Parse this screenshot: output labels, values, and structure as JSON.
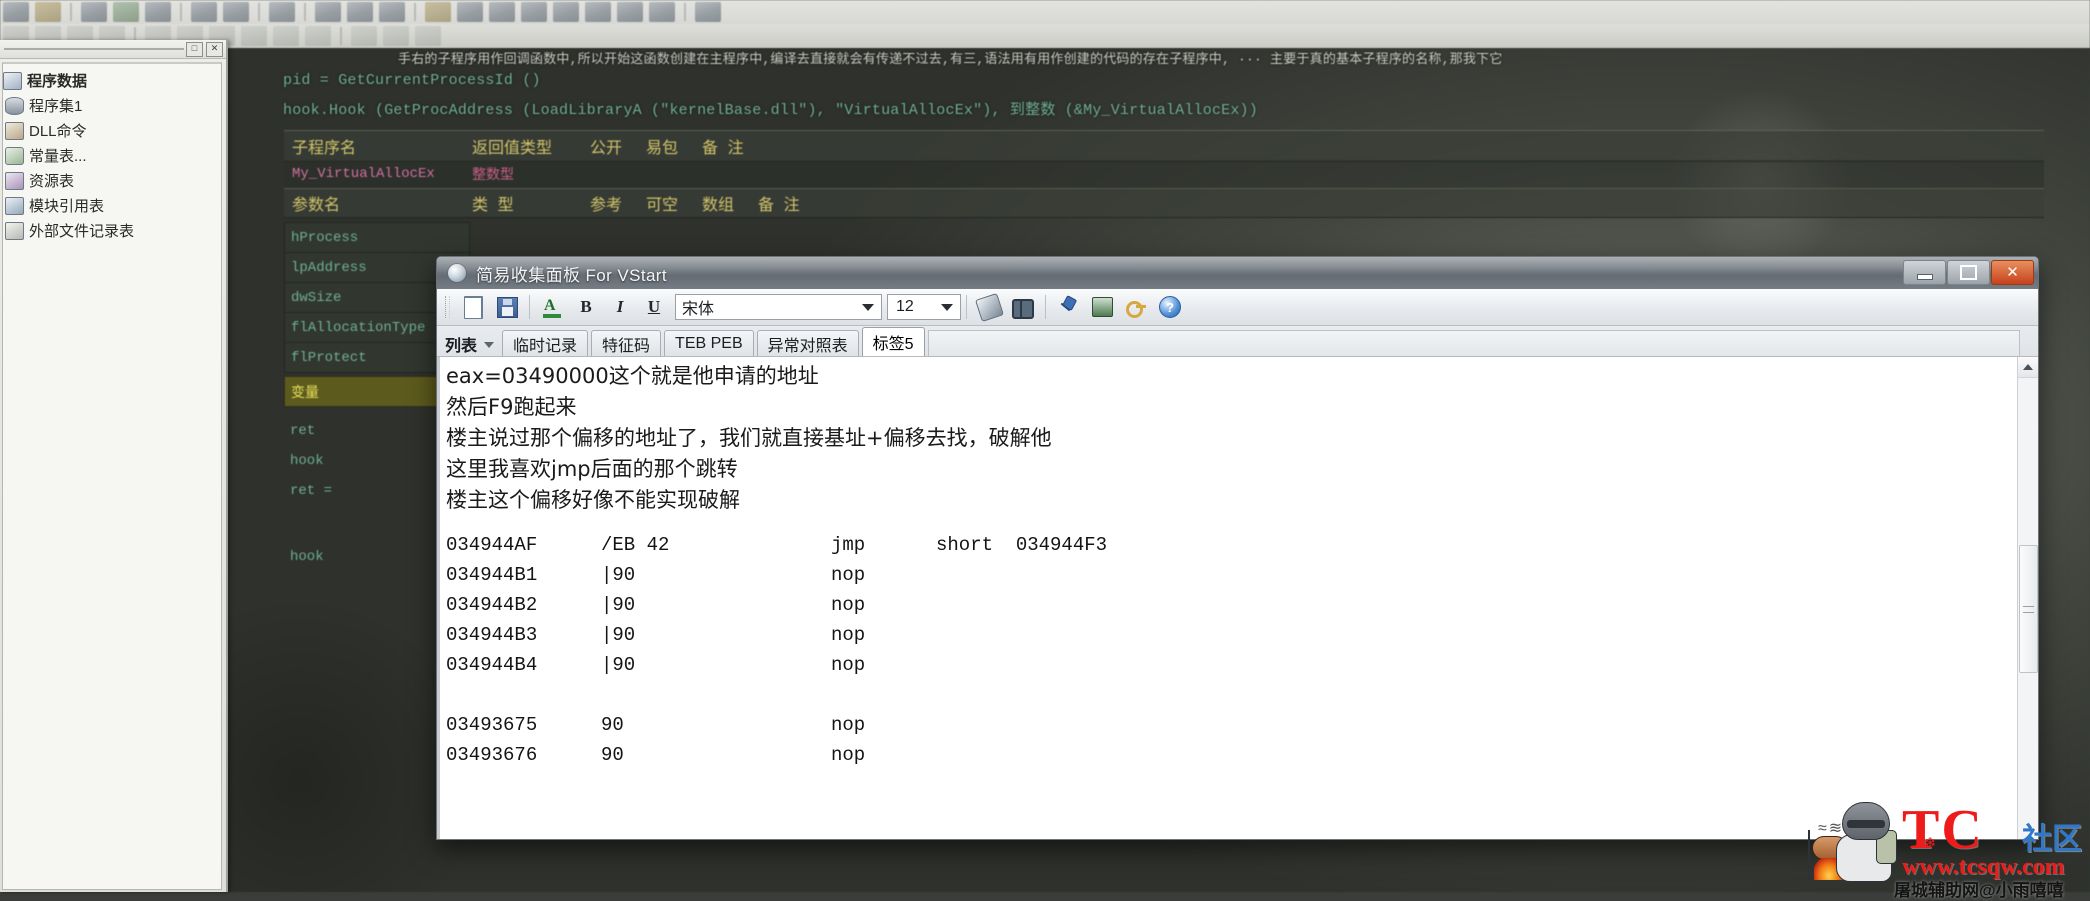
{
  "toolbar_top": {
    "row1_icons": [
      "open-icon",
      "save-icon",
      "run-icon",
      "debug-icon",
      "copy-icon",
      "paste-icon",
      "undo-icon",
      "redo-icon",
      "zoom-icon",
      "window-icon",
      "layout-icon",
      "grid-icon",
      "play-icon",
      "stop-icon",
      "settings-icon",
      "step-icon",
      "step-over-icon",
      "step-out-icon",
      "watch-icon",
      "breakpoint-icon",
      "search-icon"
    ],
    "row2_icons": [
      "align-left-icon",
      "align-center-icon",
      "align-right-icon",
      "spacing-icon",
      "group-icon",
      "ungroup-icon",
      "bring-front-icon",
      "send-back-icon",
      "size-width-icon",
      "size-height-icon",
      "table-icon",
      "list-icon",
      "property-icon"
    ]
  },
  "left_panel": {
    "caption_buttons": [
      "restore-button",
      "close-button"
    ],
    "items": [
      {
        "label": "程序数据",
        "icon": "folder-icon",
        "root": true
      },
      {
        "label": "程序集1",
        "icon": "assembly-icon",
        "root": false
      },
      {
        "label": "DLL命令",
        "icon": "dll-icon",
        "root": false
      },
      {
        "label": "常量表...",
        "icon": "constant-icon",
        "root": false
      },
      {
        "label": "资源表",
        "icon": "resource-icon",
        "root": false
      },
      {
        "label": "模块引用表",
        "icon": "module-icon",
        "root": false
      },
      {
        "label": "外部文件记录表",
        "icon": "file-icon",
        "root": false
      }
    ]
  },
  "editor": {
    "code_lines": [
      "pid = GetCurrentProcessId ()",
      "hook.Hook (GetProcAddress (LoadLibraryA (\"kernelBase.dll\"), \"VirtualAllocEx\"), 到整数 (&My_VirtualAllocEx))"
    ],
    "comment_line": "手右的子程序用作回调函数中,所以开始这函数创建在主程序中,编译去直接就会有传递不过去,有三,语法用有用作创建的代码的存在子程序中, ··· 主要于真的基本子程序的名称,那我下它",
    "sub_header": [
      "子程序名",
      "返回值类型",
      "公开",
      "易包",
      "备 注"
    ],
    "sub_row": {
      "name": "My_VirtualAllocEx",
      "ret": "整数型"
    },
    "param_header": [
      "参数名",
      "类 型",
      "参考",
      "可空",
      "数组",
      "备 注"
    ],
    "params": [
      {
        "name": "hProcess",
        "selected": false
      },
      {
        "name": "lpAddress",
        "selected": false
      },
      {
        "name": "dwSize",
        "selected": false
      },
      {
        "name": "flAllocationType",
        "selected": false
      },
      {
        "name": "flProtect",
        "selected": false
      },
      {
        "name": "变量",
        "selected": true
      },
      {
        "name": "ret",
        "selected": false
      },
      {
        "name": "hook",
        "selected": false
      },
      {
        "name": "ret =",
        "selected": false
      },
      {
        "name": "hook",
        "selected": false
      }
    ]
  },
  "dialog": {
    "title": "简易收集面板 For VStart",
    "icon": "app-icon",
    "window_buttons": {
      "minimize": "minimize-button",
      "maximize": "maximize-button",
      "close": "close-button"
    },
    "toolbar": {
      "new_label": "new-document-icon",
      "save_label": "save-icon",
      "font_color_label": "font-color-icon",
      "bold_label": "B",
      "italic_label": "I",
      "underline_label": "U",
      "font_name": "宋体",
      "font_size": "12",
      "bucket_label": "fill-color-icon",
      "find_label": "find-icon",
      "pin_label": "pin-icon",
      "book_label": "book-icon",
      "key_label": "key-icon",
      "help_label": "?"
    },
    "tabs": [
      {
        "label": "列表",
        "active": false,
        "first": true
      },
      {
        "label": "临时记录",
        "active": false,
        "first": false
      },
      {
        "label": "特征码",
        "active": false,
        "first": false
      },
      {
        "label": "TEB PEB",
        "active": false,
        "first": false
      },
      {
        "label": "异常对照表",
        "active": false,
        "first": false
      },
      {
        "label": "标签5",
        "active": true,
        "first": false
      }
    ],
    "notes": [
      "eax=03490000这个就是他申请的地址",
      "然后F9跑起来",
      "楼主说过那个偏移的地址了，我们就直接基址+偏移去找，破解他",
      "这里我喜欢jmp后面的那个跳转",
      "楼主这个偏移好像不能实现破解"
    ],
    "disassembly": [
      {
        "addr": "034944AF",
        "bytes": "/EB 42",
        "mnemonic": "jmp",
        "operand": "short  034944F3"
      },
      {
        "addr": "034944B1",
        "bytes": "|90",
        "mnemonic": "nop",
        "operand": ""
      },
      {
        "addr": "034944B2",
        "bytes": "|90",
        "mnemonic": "nop",
        "operand": ""
      },
      {
        "addr": "034944B3",
        "bytes": "|90",
        "mnemonic": "nop",
        "operand": ""
      },
      {
        "addr": "034944B4",
        "bytes": "|90",
        "mnemonic": "nop",
        "operand": ""
      }
    ],
    "disassembly2": [
      {
        "addr": "03493675",
        "bytes": "90",
        "mnemonic": "nop",
        "operand": ""
      },
      {
        "addr": "03493676",
        "bytes": "90",
        "mnemonic": "nop",
        "operand": ""
      }
    ],
    "scrollbar": {
      "up": "scroll-up-arrow",
      "down": "scroll-down-arrow"
    }
  },
  "watermark": {
    "brand": "TC",
    "community": "社区",
    "url": "www.tcsqw.com",
    "subtitle": "屠城辅助网@小雨嘻嘻",
    "steam": "≈≋"
  },
  "colors": {
    "accent_red": "#ee1b1b",
    "accent_blue": "#2f77c9",
    "titlebar": "#757c83",
    "close_button": "#c7421c"
  }
}
